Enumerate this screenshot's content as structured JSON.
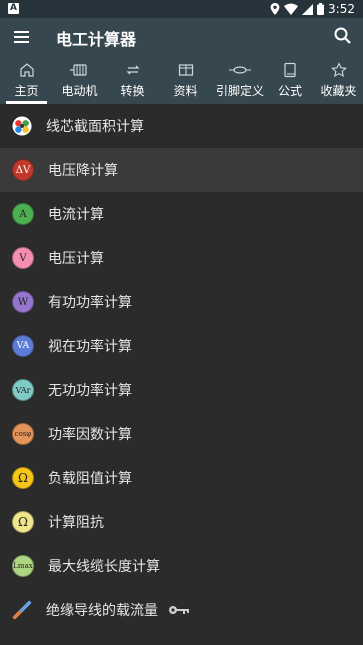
{
  "status": {
    "app_letter": "A",
    "time": "3:52"
  },
  "toolbar": {
    "title": "电工计算器"
  },
  "tabs": [
    {
      "label": "主页",
      "icon": "home-icon"
    },
    {
      "label": "电动机",
      "icon": "motor-icon"
    },
    {
      "label": "转换",
      "icon": "convert-icon"
    },
    {
      "label": "资料",
      "icon": "table-icon"
    },
    {
      "label": "引脚定义",
      "icon": "pinout-icon"
    },
    {
      "label": "公式",
      "icon": "book-icon"
    },
    {
      "label": "收藏夹",
      "icon": "star-icon"
    }
  ],
  "items": [
    {
      "label": "线芯截面积计算",
      "badge": "",
      "color": "#3a5fa0"
    },
    {
      "label": "电压降计算",
      "badge": "ΔV",
      "color": "#c0392b"
    },
    {
      "label": "电流计算",
      "badge": "A",
      "color": "#4caf50"
    },
    {
      "label": "电压计算",
      "badge": "V",
      "color": "#f48fb1"
    },
    {
      "label": "有功功率计算",
      "badge": "W",
      "color": "#9575cd"
    },
    {
      "label": "视在功率计算",
      "badge": "VA",
      "color": "#5c7bd6"
    },
    {
      "label": "无功功率计算",
      "badge": "VAr",
      "color": "#80cbc4"
    },
    {
      "label": "功率因数计算",
      "badge": "cosφ",
      "color": "#e6955a"
    },
    {
      "label": "负载阻值计算",
      "badge": "Ω",
      "color": "#f5c518"
    },
    {
      "label": "计算阻抗",
      "badge": "Ω",
      "color": "#f0e68c"
    },
    {
      "label": "最大线缆长度计算",
      "badge": "Lmax",
      "color": "#aed581"
    },
    {
      "label": "绝缘导线的载流量",
      "badge": "",
      "color": "#6aa0e0"
    }
  ]
}
